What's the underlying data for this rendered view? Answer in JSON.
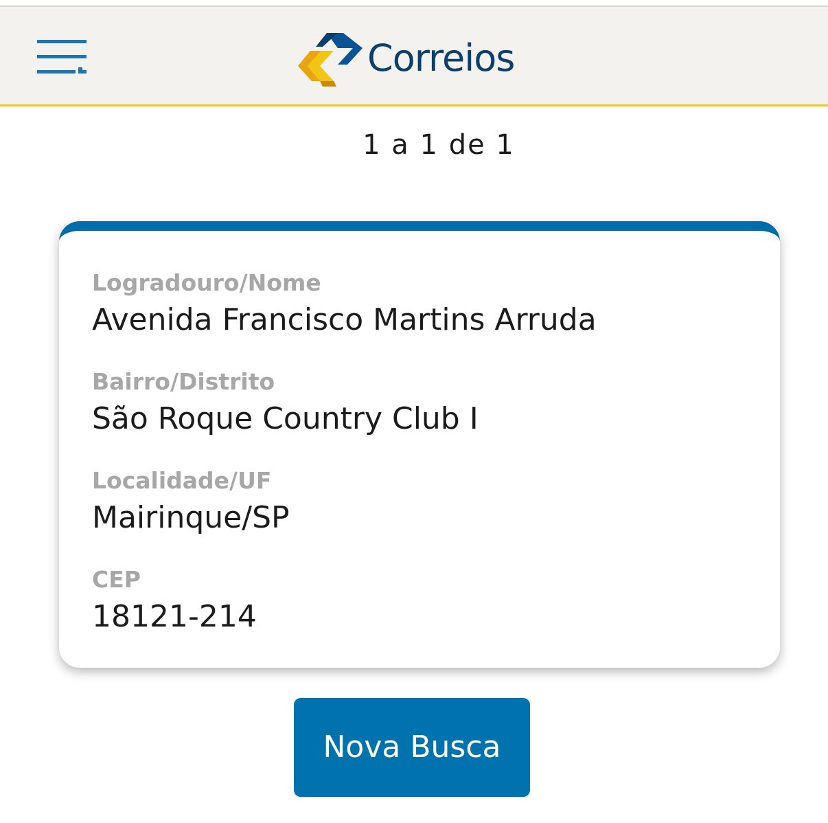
{
  "header": {
    "menu_icon": "hamburger-menu-icon",
    "logo_text": "Correios",
    "colors": {
      "background": "#f3f2ef",
      "accent_line": "#f2c622",
      "brand_blue": "#0b3f6e",
      "brand_yellow": "#f2b705"
    }
  },
  "results": {
    "pagination": "1 a 1 de 1"
  },
  "card": {
    "accent": "#006ca9",
    "fields": [
      {
        "label": "Logradouro/Nome",
        "value": "Avenida Francisco Martins Arruda"
      },
      {
        "label": "Bairro/Distrito",
        "value": "São Roque Country Club I"
      },
      {
        "label": "Localidade/UF",
        "value": "Mairinque/SP"
      },
      {
        "label": "CEP",
        "value": "18121-214"
      }
    ]
  },
  "actions": {
    "new_search_label": "Nova Busca",
    "button_color": "#0072ae"
  }
}
